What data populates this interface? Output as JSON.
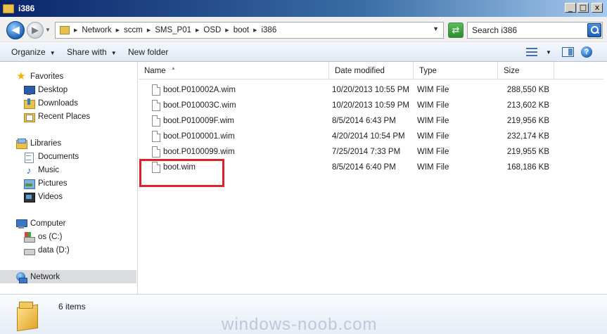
{
  "window": {
    "title": "i386",
    "minimize": "_",
    "maximize": "□",
    "close": "x"
  },
  "address": {
    "breadcrumbs": [
      "Network",
      "sccm",
      "SMS_P01",
      "OSD",
      "boot",
      "i386"
    ],
    "search_placeholder": "Search i386"
  },
  "toolbar": {
    "organize": "Organize",
    "share_with": "Share with",
    "new_folder": "New folder"
  },
  "nav": {
    "favorites": "Favorites",
    "desktop": "Desktop",
    "downloads": "Downloads",
    "recent_places": "Recent Places",
    "libraries": "Libraries",
    "documents": "Documents",
    "music": "Music",
    "pictures": "Pictures",
    "videos": "Videos",
    "computer": "Computer",
    "drive_c": "os (C:)",
    "drive_d": "data (D:)",
    "network": "Network"
  },
  "columns": {
    "name": "Name",
    "date_modified": "Date modified",
    "type": "Type",
    "size": "Size"
  },
  "files": [
    {
      "name": "boot.P010002A.wim",
      "date": "10/20/2013 10:55 PM",
      "type": "WIM File",
      "size": "288,550 KB"
    },
    {
      "name": "boot.P010003C.wim",
      "date": "10/20/2013 10:59 PM",
      "type": "WIM File",
      "size": "213,602 KB"
    },
    {
      "name": "boot.P010009F.wim",
      "date": "8/5/2014 6:43 PM",
      "type": "WIM File",
      "size": "219,956 KB"
    },
    {
      "name": "boot.P0100001.wim",
      "date": "4/20/2014 10:54 PM",
      "type": "WIM File",
      "size": "232,174 KB"
    },
    {
      "name": "boot.P0100099.wim",
      "date": "7/25/2014 7:33 PM",
      "type": "WIM File",
      "size": "219,955 KB"
    },
    {
      "name": "boot.wim",
      "date": "8/5/2014 6:40 PM",
      "type": "WIM File",
      "size": "168,186 KB"
    }
  ],
  "status": {
    "item_count": "6 items"
  },
  "watermark": "windows-noob.com",
  "colors": {
    "highlight": "#e0202a",
    "selected_nav": "#dadcdf"
  }
}
